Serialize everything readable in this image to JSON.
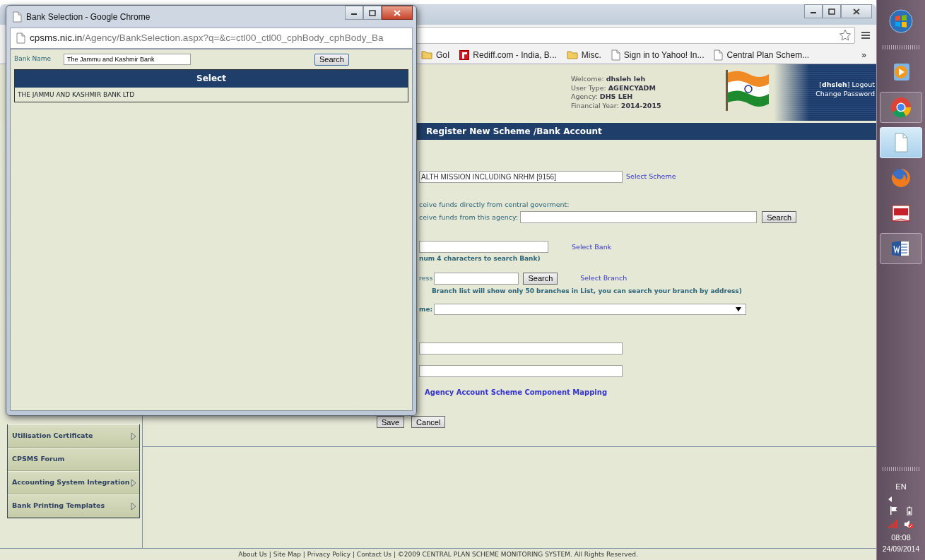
{
  "popup": {
    "title": "Bank Selection - Google Chrome",
    "url_host": "cpsms.nic.in",
    "url_path": "/Agency/BankSelection.aspx?q=&c=ctl00_ctl00_cphBody_cphBody_Ba",
    "search": {
      "label": "Bank Name",
      "value": "The Jammu and Kashmir Bank",
      "button": "Search"
    },
    "results": {
      "columns": [
        "Select"
      ],
      "rows": [
        "THE JAMMU AND KASHMIR BANK LTD"
      ]
    }
  },
  "browser": {
    "bookmarks": [
      {
        "kind": "folder",
        "label": "GoI"
      },
      {
        "kind": "site",
        "label": "Rediff.com - India, B..."
      },
      {
        "kind": "folder",
        "label": "Misc."
      },
      {
        "kind": "page",
        "label": "Sign in to Yahoo! In..."
      },
      {
        "kind": "page",
        "label": "Central Plan Schem..."
      }
    ],
    "overflow": "»"
  },
  "header": {
    "info": [
      {
        "label": "Welcome:",
        "value": "dhsleh leh"
      },
      {
        "label": "User Type:",
        "value": "AGENCYADM"
      },
      {
        "label": "Agency:",
        "value": "DHS LEH"
      },
      {
        "label": "Financial Year:",
        "value": "2014-2015"
      }
    ],
    "user": "[**dhsleh**]",
    "logout": "Logout",
    "change_password": "Change Password"
  },
  "menu": [
    {
      "label": "Utilisation Certificate",
      "has_submenu": true
    },
    {
      "label": "CPSMS Forum",
      "has_submenu": false
    },
    {
      "label": "Accounting System Integration",
      "has_submenu": true
    },
    {
      "label": "Bank Printing Templates",
      "has_submenu": true
    }
  ],
  "page_title": "Register New Scheme /Bank Account",
  "form": {
    "rows": [
      {
        "kind": "field-link",
        "value": "ALTH MISSION INCLUDING NRHM [9156]",
        "link": "Select Scheme"
      },
      {
        "kind": "text",
        "text": "ceive funds directly from central goverment:"
      },
      {
        "kind": "label-field-button",
        "label": "ceive funds from this agency:",
        "button": "Search"
      },
      {
        "kind": "field-link",
        "link": "Select Bank"
      },
      {
        "kind": "note",
        "text": "num 4 characters to search Bank)"
      },
      {
        "kind": "label-field-button-link",
        "label": "ress",
        "button": "Search",
        "link": "Select Branch"
      },
      {
        "kind": "note",
        "text": "Branch list will show only 50 branches in List, you can search your branch by address)"
      },
      {
        "kind": "label-select",
        "label": "me:"
      },
      {
        "kind": "field"
      },
      {
        "kind": "field"
      },
      {
        "kind": "link",
        "text": "Agency Account Scheme Component Mapping"
      }
    ],
    "actions": [
      "Save",
      "Cancel"
    ]
  },
  "footer": {
    "links": [
      "About Us",
      "Site Map",
      "Privacy Policy",
      "Contact Us"
    ],
    "separator": "|",
    "copyright": "©2009 CENTRAL PLAN SCHEME MONITORING SYSTEM. All Rights Reserved."
  },
  "taskbar": {
    "apps": [
      {
        "kind": "media",
        "running": false,
        "selected": false
      },
      {
        "kind": "chrome",
        "running": true,
        "selected": false
      },
      {
        "kind": "document",
        "running": true,
        "selected": true
      },
      {
        "kind": "firefox",
        "running": false,
        "selected": false
      },
      {
        "kind": "tally",
        "running": false,
        "selected": false
      },
      {
        "kind": "word",
        "running": true,
        "selected": false
      }
    ],
    "language": "EN",
    "time": "08:08",
    "date": "24/09/2014"
  }
}
